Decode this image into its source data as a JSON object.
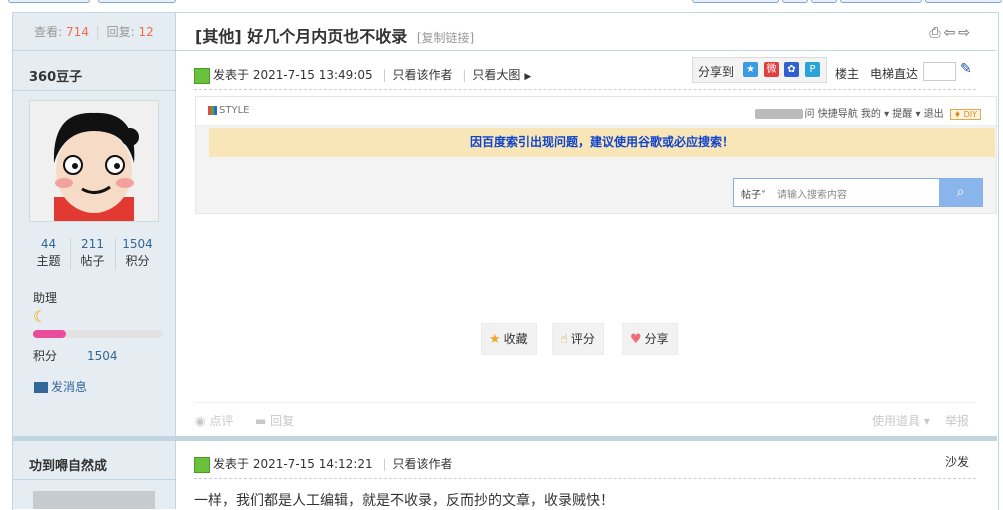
{
  "thread": {
    "views_label": "查看:",
    "views": "714",
    "replies_label": "回复:",
    "replies": "12",
    "category": "[其他]",
    "title": "好几个月内页也不收录",
    "copy_link": "[复制链接]"
  },
  "post1": {
    "author": "360豆子",
    "stats": [
      {
        "value": "44",
        "label": "主题"
      },
      {
        "value": "211",
        "label": "帖子"
      },
      {
        "value": "1504",
        "label": "积分"
      }
    ],
    "rank": "助理",
    "points_label": "积分",
    "points": "1504",
    "level_progress": 0.25,
    "send_message": "发消息",
    "posted": "发表于 2021-7-15 13:49:05",
    "only_author": "只看该作者",
    "big_image": "只看大图",
    "share_to": "分享到",
    "floor": "楼主",
    "jump": "电梯直达",
    "screenshot": {
      "logo": "STYLE",
      "nav": [
        "问",
        "快捷导航",
        "我的",
        "提醒",
        "退出"
      ],
      "diy": "DIY",
      "notice": "因百度索引出现问题，建议使用谷歌或必应搜索！",
      "search_scope": "帖子",
      "search_placeholder": "请输入搜索内容"
    },
    "actions": [
      {
        "icon": "star-icon",
        "glyph": "★",
        "label": "收藏",
        "color": "#f5a623"
      },
      {
        "icon": "thumb-icon",
        "glyph": "👍",
        "label": "评分",
        "color": "#d99a3a"
      },
      {
        "icon": "heart-icon",
        "glyph": "♥",
        "label": "分享",
        "color": "#f06a7a"
      }
    ],
    "footer": {
      "comment": "点评",
      "reply": "回复",
      "use_tool": "使用道具",
      "report": "举报"
    }
  },
  "post2": {
    "author": "功到嘚自然成",
    "posted": "发表于 2021-7-15 14:12:21",
    "only_author": "只看该作者",
    "floor": "沙发",
    "content": "一样，我们都是人工编辑，就是不收录，反而抄的文章，收录贼快！"
  }
}
